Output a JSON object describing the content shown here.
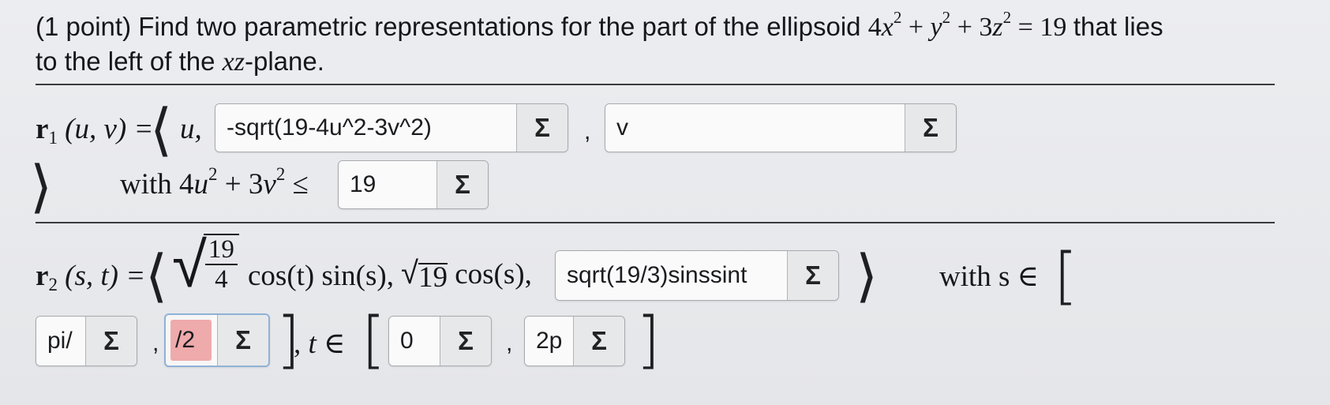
{
  "question": {
    "points": "(1 point)",
    "text_a": "Find two parametric representations for the part of the ellipsoid",
    "equation_parts": [
      "4",
      "x",
      "2",
      " + ",
      "y",
      "2",
      " + 3",
      "z",
      "2",
      " = 19"
    ],
    "text_b": "that lies",
    "line2_a": "to the left of the",
    "plane_var": "xz",
    "line2_b": "-plane."
  },
  "r1": {
    "label": "r",
    "sub": "1",
    "args": "(u, v) =",
    "first": "u,",
    "y_value": "-sqrt(19-4u^2-3v^2)",
    "z_value": "v",
    "with_text": "with 4",
    "cond_u": "u",
    "cond_mid": " + 3",
    "cond_v": "v",
    "exp": "2",
    "leq": " ≤",
    "bound_value": "19"
  },
  "r2": {
    "label": "r",
    "sub": "2",
    "args": "(s, t) =",
    "frac_num": "19",
    "frac_den": "4",
    "after_frac": "cos(t) sin(s),",
    "sqrt_inner": "19",
    "after_sqrt": "cos(s),",
    "z_value": "sqrt(19/3)sinssint",
    "with_s": "with s ∈",
    "s_low": "pi/",
    "s_high": "/2",
    "t_label": ", t ∈",
    "t_low": "0",
    "t_high": "2p"
  },
  "ui": {
    "sigma": "Σ",
    "comma": ",",
    "langle": "⟨",
    "rangle": "⟩",
    "lbracket": "[",
    "rbracket": "]"
  },
  "colors": {
    "incorrect_fill": "#efaaab",
    "focus_border": "#8fb2d6"
  }
}
